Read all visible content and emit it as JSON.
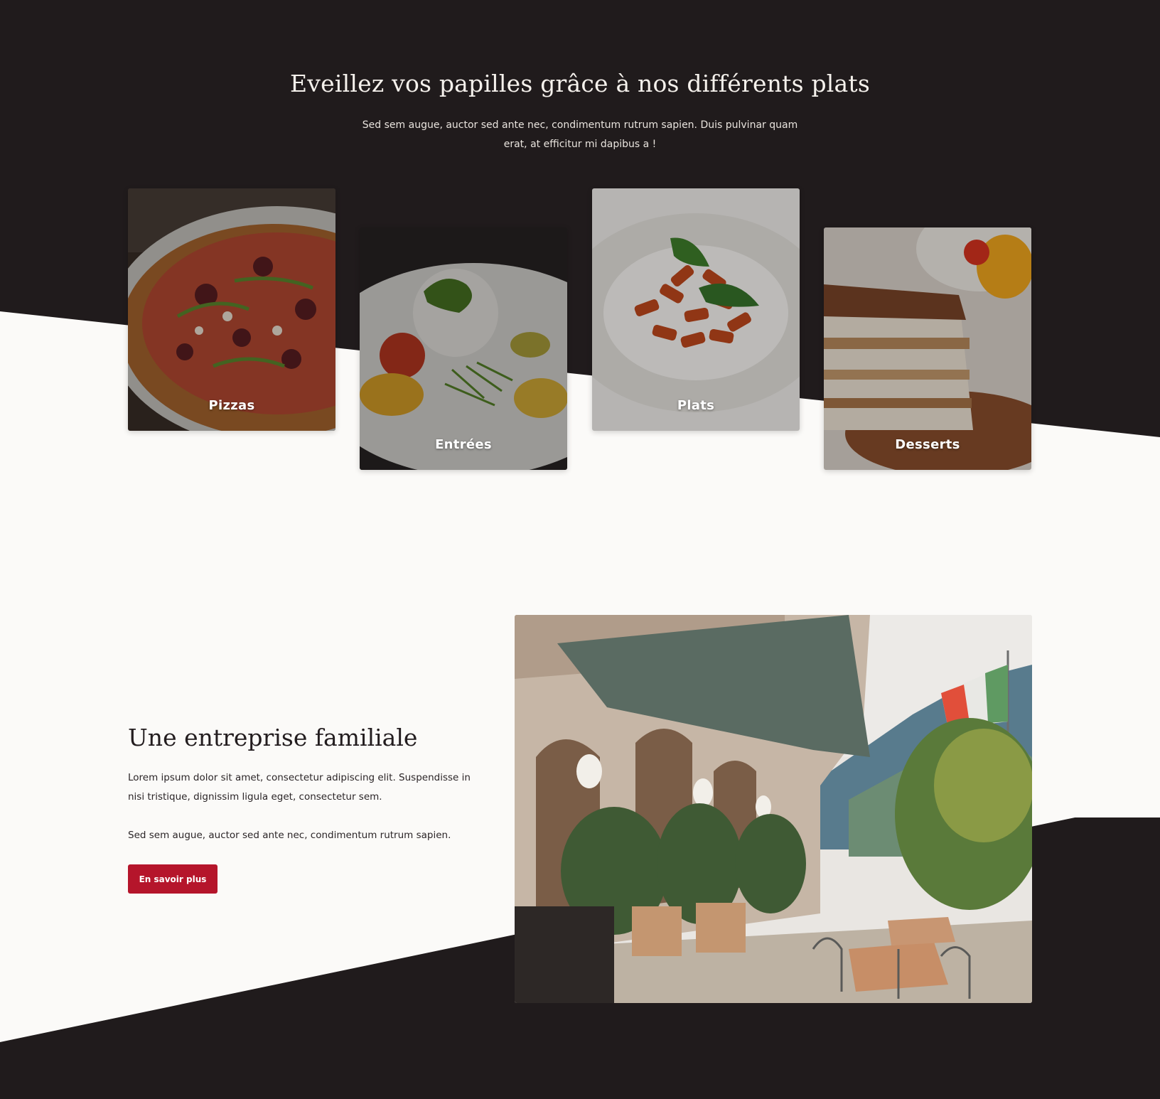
{
  "colors": {
    "dark_bg": "#201b1c",
    "light_bg": "#fbfaf8",
    "accent": "#b5152b",
    "text_light": "#f5f1ec",
    "text_dark": "#231d1f"
  },
  "menu_section": {
    "title": "Eveillez vos papilles grâce à nos différents plats",
    "description": "Sed sem augue, auctor sed ante nec, condimentum rutrum sapien. Duis pulvinar quam erat, at efficitur mi dapibus a !",
    "cards": [
      {
        "label": "Pizzas",
        "image": "pizza-photo"
      },
      {
        "label": "Entrées",
        "image": "burrata-starter-photo"
      },
      {
        "label": "Plats",
        "image": "rigatoni-pasta-photo"
      },
      {
        "label": "Desserts",
        "image": "tiramisu-photo"
      }
    ]
  },
  "about_section": {
    "title": "Une entreprise familiale",
    "paragraph_1": "Lorem ipsum dolor sit amet, consectetur adipiscing elit. Suspendisse in nisi tristique, dignissim ligula eget, consectetur sem.",
    "paragraph_2": "Sed sem augue, auctor sed ante nec, condimentum rutrum sapien.",
    "button_label": "En savoir plus",
    "image": "restaurant-terrace-photo"
  }
}
